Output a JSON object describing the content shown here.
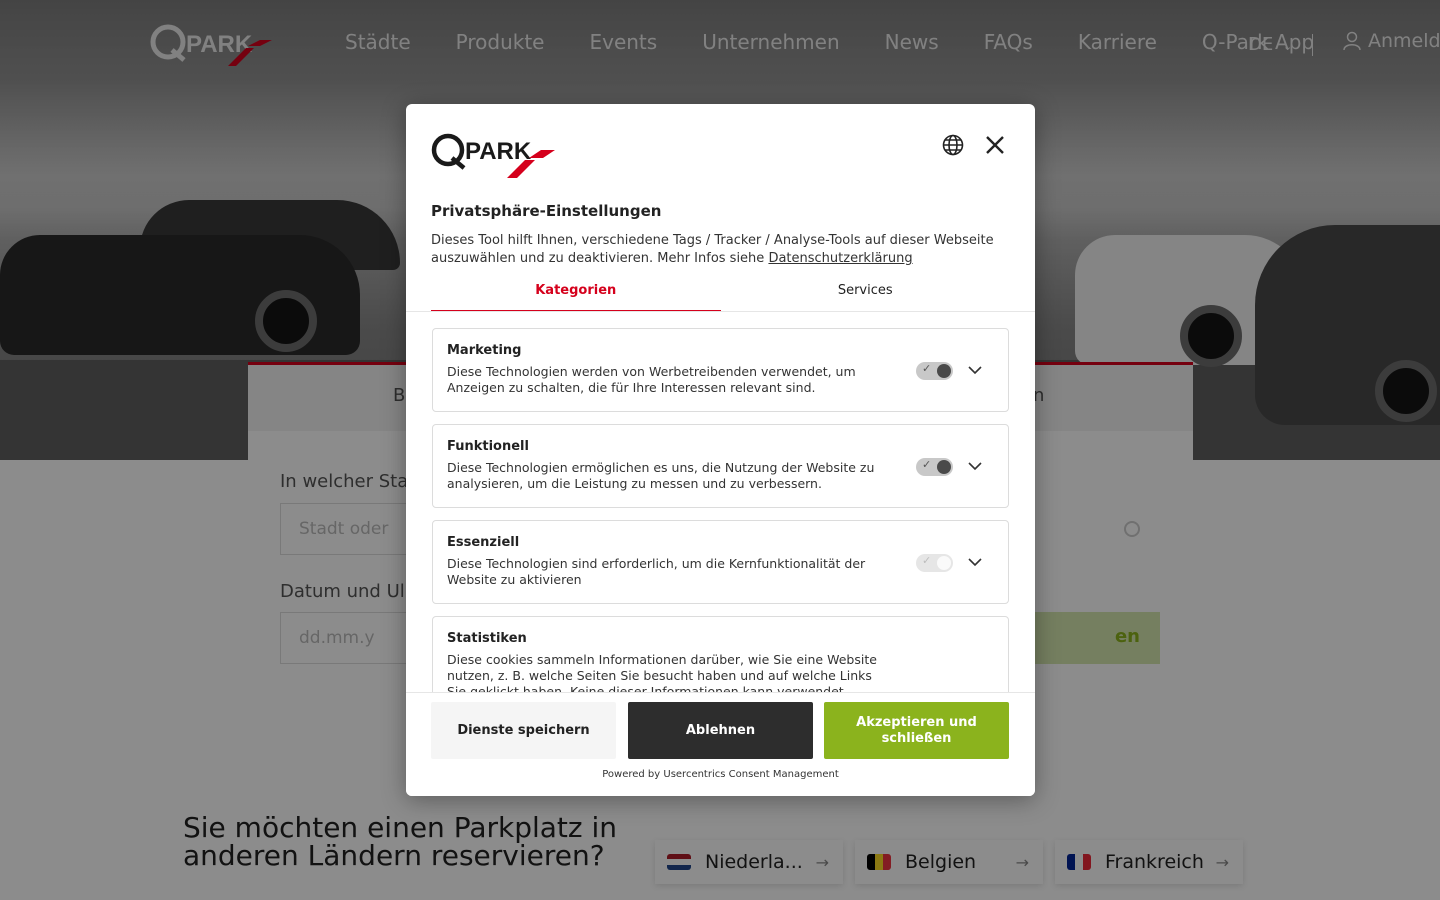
{
  "nav": {
    "links": [
      "Städte",
      "Produkte",
      "Events",
      "Unternehmen",
      "News",
      "FAQs",
      "Karriere",
      "Q-Park App"
    ],
    "language": "DE",
    "login": "Anmeld"
  },
  "background": {
    "tab_fragment_left": "B",
    "tab_fragment_right": "n",
    "city_label": "In welcher Sta",
    "city_placeholder": "Stadt oder",
    "date_label": "Datum und Ul",
    "date_placeholder": "dd.mm.y",
    "go_button_fragment": "en",
    "countries_title": "Sie möchten einen Parkplatz in anderen Ländern reservieren?",
    "countries": [
      {
        "name": "Niederla...",
        "flag": "nl"
      },
      {
        "name": "Belgien",
        "flag": "be"
      },
      {
        "name": "Frankreich",
        "flag": "fr"
      }
    ]
  },
  "dialog": {
    "title": "Privatsphäre-Einstellungen",
    "description": "Dieses Tool hilft Ihnen, verschiedene Tags / Tracker / Analyse-Tools auf dieser Webseite auszuwählen und zu deaktivieren. Mehr Infos siehe",
    "privacy_link": "Datenschutzerklärung",
    "tabs": [
      "Kategorien",
      "Services"
    ],
    "active_tab": "Kategorien",
    "categories": [
      {
        "name": "Marketing",
        "description": "Diese Technologien werden von Werbetreibenden verwendet, um Anzeigen zu schalten, die für Ihre Interessen relevant sind.",
        "enabled": true,
        "locked": false
      },
      {
        "name": "Funktionell",
        "description": "Diese Technologien ermöglichen es uns, die Nutzung der Website zu analysieren, um die Leistung zu messen und zu verbessern.",
        "enabled": true,
        "locked": false
      },
      {
        "name": "Essenziell",
        "description": "Diese Technologien sind erforderlich, um die Kernfunktionalität der Website zu aktivieren",
        "enabled": true,
        "locked": true
      },
      {
        "name": "Statistiken",
        "description": "Diese cookies sammeln Informationen darüber, wie Sie eine Website nutzen, z. B. welche Seiten Sie besucht haben und auf welche Links Sie geklickt haben. Keine dieser Informationen kann verwendet werden, um",
        "enabled": true,
        "locked": false
      }
    ],
    "buttons": {
      "save": "Dienste speichern",
      "deny": "Ablehnen",
      "accept": "Akzeptieren und schließen"
    },
    "powered_by": "Powered by Usercentrics Consent Management",
    "colors": {
      "brand_red": "#d5001c",
      "accept_green": "#8bb31d",
      "deny_dark": "#2d2d2d"
    }
  }
}
